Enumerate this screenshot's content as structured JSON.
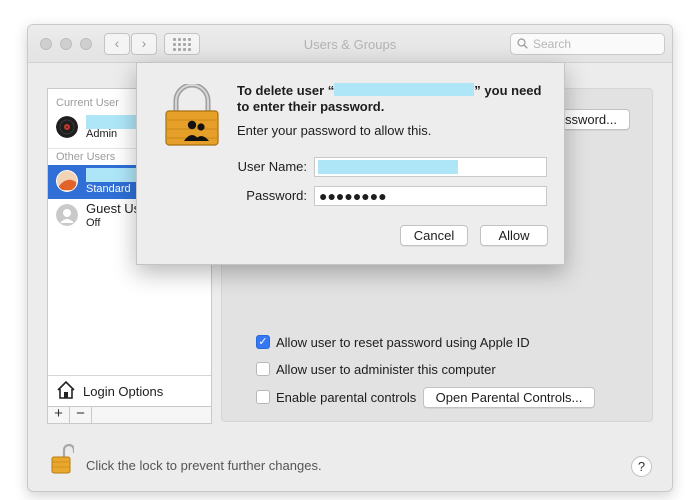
{
  "window": {
    "title": "Users & Groups",
    "search_placeholder": "Search",
    "nav_back": "‹",
    "nav_forward": "›"
  },
  "sidebar": {
    "current_user_header": "Current User",
    "other_users_header": "Other Users",
    "current_user": {
      "role": "Admin"
    },
    "selected_user": {
      "role": "Standard"
    },
    "guest_user": {
      "name": "Guest Us",
      "role": "Off"
    },
    "login_options_label": "Login Options",
    "add_label": "+",
    "remove_label": "−"
  },
  "content": {
    "change_password_button": "ssword...",
    "checkboxes": [
      {
        "label": "Allow user to reset password using Apple ID",
        "checked": true
      },
      {
        "label": "Allow user to administer this computer",
        "checked": false
      },
      {
        "label": "Enable parental controls",
        "checked": false
      }
    ],
    "open_parental_controls_button": "Open Parental Controls..."
  },
  "footer": {
    "lock_text": "Click the lock to prevent further changes.",
    "help_label": "?"
  },
  "dialog": {
    "title_before": "To delete user “",
    "title_after": "” you need",
    "title_line2": "to enter their password.",
    "subtitle": "Enter your password to allow this.",
    "username_label": "User Name:",
    "password_label": "Password:",
    "password_value": "●●●●●●●●",
    "cancel_button": "Cancel",
    "allow_button": "Allow"
  },
  "colors": {
    "redaction": "#aee6f8",
    "selection": "#2f6fd6",
    "checkbox_accent": "#3478f6"
  }
}
